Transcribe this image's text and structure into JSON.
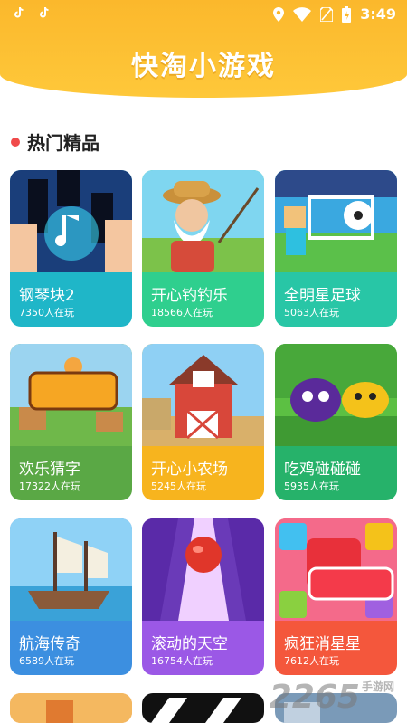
{
  "status_bar": {
    "time": "3:49"
  },
  "header": {
    "title": "快淘小游戏"
  },
  "section": {
    "title": "热门精品"
  },
  "player_suffix": "人在玩",
  "games": [
    {
      "name": "钢琴块2",
      "players": "7350",
      "color": "#1fb6c8"
    },
    {
      "name": "开心钓钓乐",
      "players": "18566",
      "color": "#2fcf8e"
    },
    {
      "name": "全明星足球",
      "players": "5063",
      "color": "#28c6a6"
    },
    {
      "name": "欢乐猜字",
      "players": "17322",
      "color": "#5aa845"
    },
    {
      "name": "开心小农场",
      "players": "5245",
      "color": "#f7b41e"
    },
    {
      "name": "吃鸡碰碰碰",
      "players": "5935",
      "color": "#26b26a"
    },
    {
      "name": "航海传奇",
      "players": "6589",
      "color": "#3c8fe0"
    },
    {
      "name": "滚动的天空",
      "players": "16754",
      "color": "#9b58e6"
    },
    {
      "name": "疯狂消星星",
      "players": "7612",
      "color": "#f4573c"
    }
  ],
  "watermark": {
    "text": "2265",
    "suffix": "手游网"
  }
}
